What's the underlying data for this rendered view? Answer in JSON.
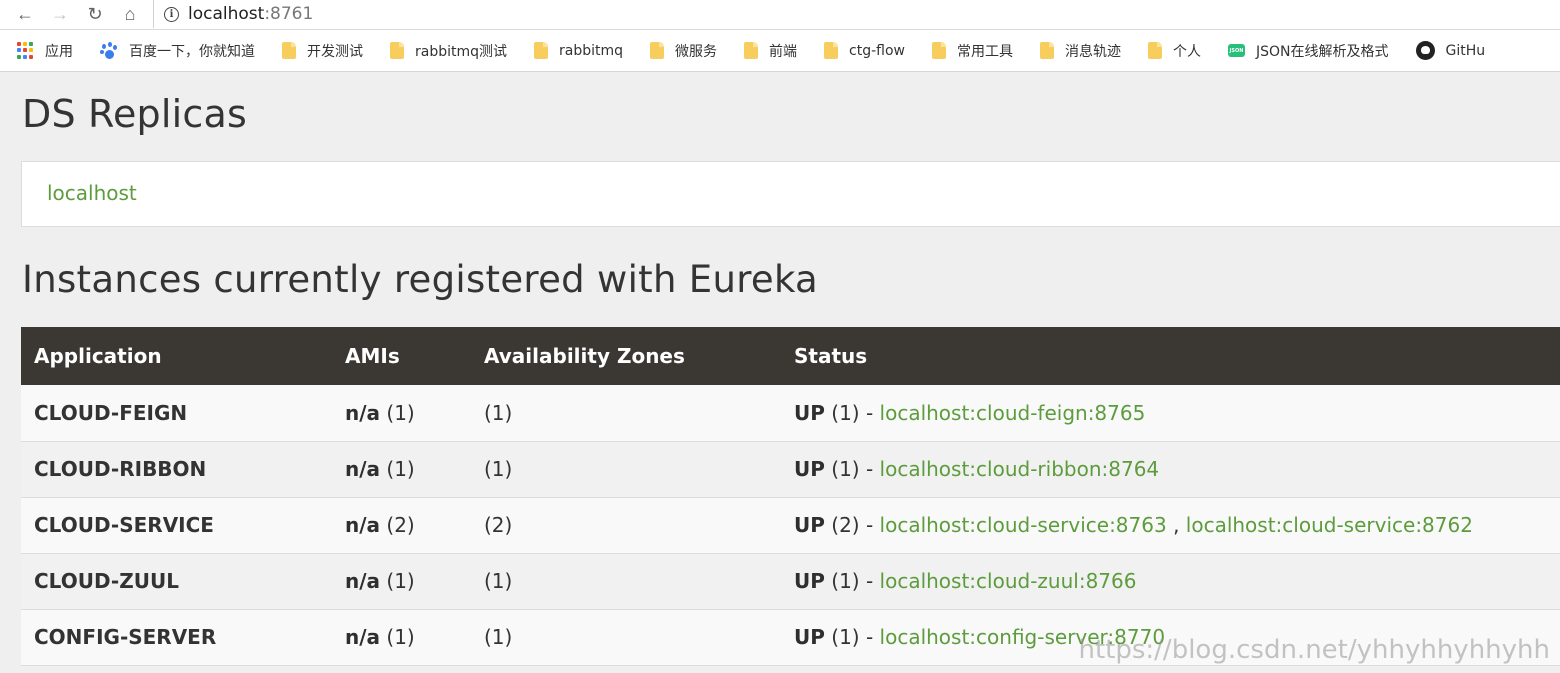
{
  "browser": {
    "url_host": "localhost",
    "url_port": ":8761",
    "bookmarks": [
      {
        "label": "应用",
        "icon": "apps-grid-icon"
      },
      {
        "label": "百度一下，你就知道",
        "icon": "baidu-paw-icon"
      },
      {
        "label": "开发测试",
        "icon": "folder-icon"
      },
      {
        "label": "rabbitmq测试",
        "icon": "folder-icon"
      },
      {
        "label": "rabbitmq",
        "icon": "folder-icon"
      },
      {
        "label": "微服务",
        "icon": "folder-icon"
      },
      {
        "label": "前端",
        "icon": "folder-icon"
      },
      {
        "label": "ctg-flow",
        "icon": "folder-icon"
      },
      {
        "label": "常用工具",
        "icon": "folder-icon"
      },
      {
        "label": "消息轨迹",
        "icon": "folder-icon"
      },
      {
        "label": "个人",
        "icon": "folder-icon"
      },
      {
        "label": "JSON在线解析及格式",
        "icon": "json-icon"
      },
      {
        "label": "GitHu",
        "icon": "github-icon"
      }
    ],
    "json_icon_text": "JSON"
  },
  "page": {
    "replicas_title": "DS Replicas",
    "replica_link": "localhost",
    "instances_title": "Instances currently registered with Eureka",
    "columns": [
      "Application",
      "AMIs",
      "Availability Zones",
      "Status"
    ],
    "rows": [
      {
        "app": "CLOUD-FEIGN",
        "ami": "n/a",
        "ami_count": "(1)",
        "zones": "(1)",
        "status": "UP",
        "status_count": "(1) -",
        "links": [
          "localhost:cloud-feign:8765"
        ]
      },
      {
        "app": "CLOUD-RIBBON",
        "ami": "n/a",
        "ami_count": "(1)",
        "zones": "(1)",
        "status": "UP",
        "status_count": "(1) -",
        "links": [
          "localhost:cloud-ribbon:8764"
        ]
      },
      {
        "app": "CLOUD-SERVICE",
        "ami": "n/a",
        "ami_count": "(2)",
        "zones": "(2)",
        "status": "UP",
        "status_count": "(2) -",
        "links": [
          "localhost:cloud-service:8763",
          "localhost:cloud-service:8762"
        ]
      },
      {
        "app": "CLOUD-ZUUL",
        "ami": "n/a",
        "ami_count": "(1)",
        "zones": "(1)",
        "status": "UP",
        "status_count": "(1) -",
        "links": [
          "localhost:cloud-zuul:8766"
        ]
      },
      {
        "app": "CONFIG-SERVER",
        "ami": "n/a",
        "ami_count": "(1)",
        "zones": "(1)",
        "status": "UP",
        "status_count": "(1) -",
        "links": [
          "localhost:config-server:8770"
        ]
      }
    ],
    "link_separator": ",",
    "watermark": "https://blog.csdn.net/yhhyhhyhhyhh"
  },
  "colors": {
    "link_green": "#5d9c3c",
    "header_dark": "#3b3833",
    "folder_yellow": "#f7ce5d"
  }
}
